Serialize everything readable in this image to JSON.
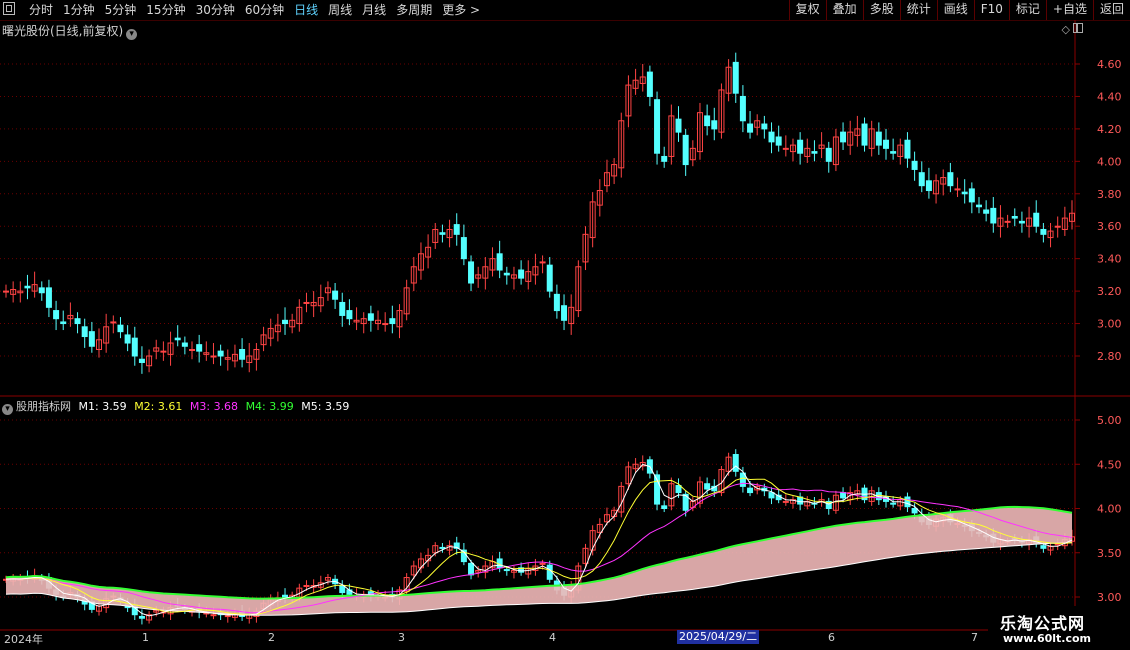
{
  "toolbar": {
    "periods": [
      "分时",
      "1分钟",
      "5分钟",
      "15分钟",
      "30分钟",
      "60分钟",
      "日线",
      "周线",
      "月线",
      "多周期",
      "更多 >"
    ],
    "active_period": "日线",
    "right_buttons": [
      "复权",
      "叠加",
      "多股",
      "统计",
      "画线",
      "F10",
      "+自选",
      "返回"
    ],
    "extra_button": "标记"
  },
  "main_title": "曙光股份(日线,前复权)",
  "main_controls": "◇",
  "indicator": {
    "name": "股朋指标网",
    "m1_label": "M1: 3.59",
    "m2_label": "M2: 3.61",
    "m3_label": "M3: 3.68",
    "m4_label": "M4: 3.99",
    "m5_label": "M5: 3.59",
    "colors": {
      "m1": "#ffffff",
      "m2": "#ffff33",
      "m3": "#ff33ff",
      "m4": "#33ff33",
      "m5": "#ffffff"
    }
  },
  "price_axis": [
    "4.60",
    "4.40",
    "4.20",
    "4.00",
    "3.80",
    "3.60",
    "3.40",
    "3.20",
    "3.00",
    "2.80"
  ],
  "ind_axis": [
    "5.00",
    "4.50",
    "4.00",
    "3.50",
    "3.00"
  ],
  "dates": {
    "year": "2024年",
    "months": [
      "1",
      "2",
      "3",
      "4",
      "6",
      "7"
    ],
    "selected": "2025/04/29/二"
  },
  "watermark": {
    "line1": "乐淘公式网",
    "line2": "www.60lt.com"
  },
  "colors": {
    "up": "#ff4444",
    "down": "#54ffff",
    "grid": "#6a0000",
    "axis_text": "#ff5a5a"
  }
}
